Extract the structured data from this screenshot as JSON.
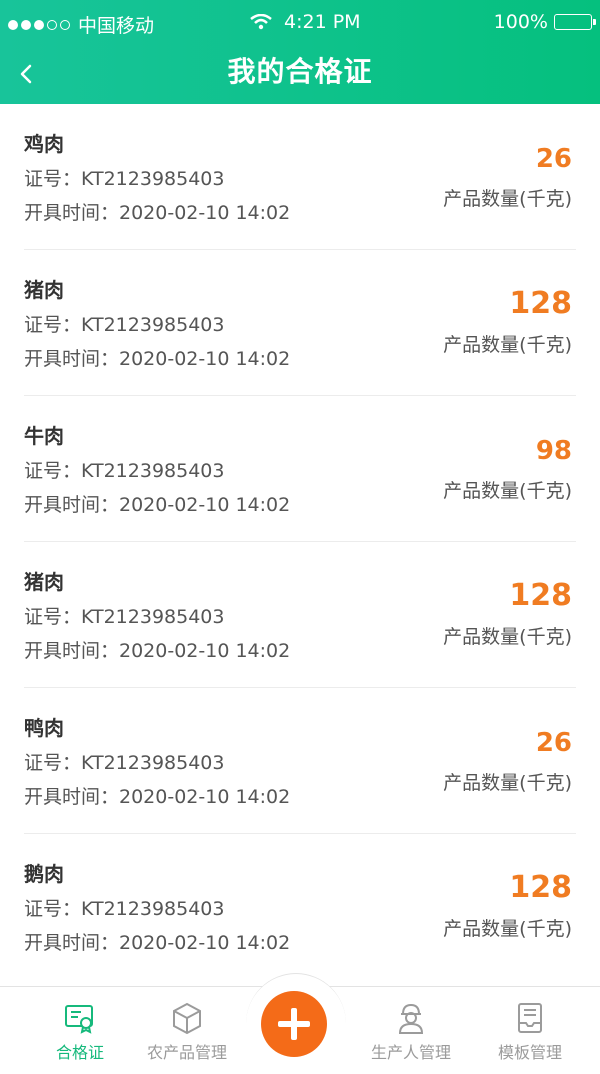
{
  "status_bar": {
    "carrier": "中国移动",
    "time": "4:21 PM",
    "battery": "100%"
  },
  "header": {
    "title": "我的合格证"
  },
  "items": [
    {
      "name": "鸡肉",
      "cert": "证号：KT2123985403",
      "time": "开具时间：2020-02-10 14:02",
      "qty": "26",
      "unit": "产品数量(千克)"
    },
    {
      "name": "猪肉",
      "cert": "证号：KT2123985403",
      "time": "开具时间：2020-02-10 14:02",
      "qty": "128",
      "unit": "产品数量(千克)"
    },
    {
      "name": "牛肉",
      "cert": "证号：KT2123985403",
      "time": "开具时间：2020-02-10 14:02",
      "qty": "98",
      "unit": "产品数量(千克)"
    },
    {
      "name": "猪肉",
      "cert": "证号：KT2123985403",
      "time": "开具时间：2020-02-10 14:02",
      "qty": "128",
      "unit": "产品数量(千克)"
    },
    {
      "name": "鸭肉",
      "cert": "证号：KT2123985403",
      "time": "开具时间：2020-02-10 14:02",
      "qty": "26",
      "unit": "产品数量(千克)"
    },
    {
      "name": "鹅肉",
      "cert": "证号：KT2123985403",
      "time": "开具时间：2020-02-10 14:02",
      "qty": "128",
      "unit": "产品数量(千克)"
    }
  ],
  "tabbar": {
    "tab1": "合格证",
    "tab2": "农产品管理",
    "tab3": "生产人管理",
    "tab4": "模板管理"
  },
  "colors": {
    "brand": "#05c07e",
    "accent": "#f07c22",
    "fab": "#f46b18"
  }
}
